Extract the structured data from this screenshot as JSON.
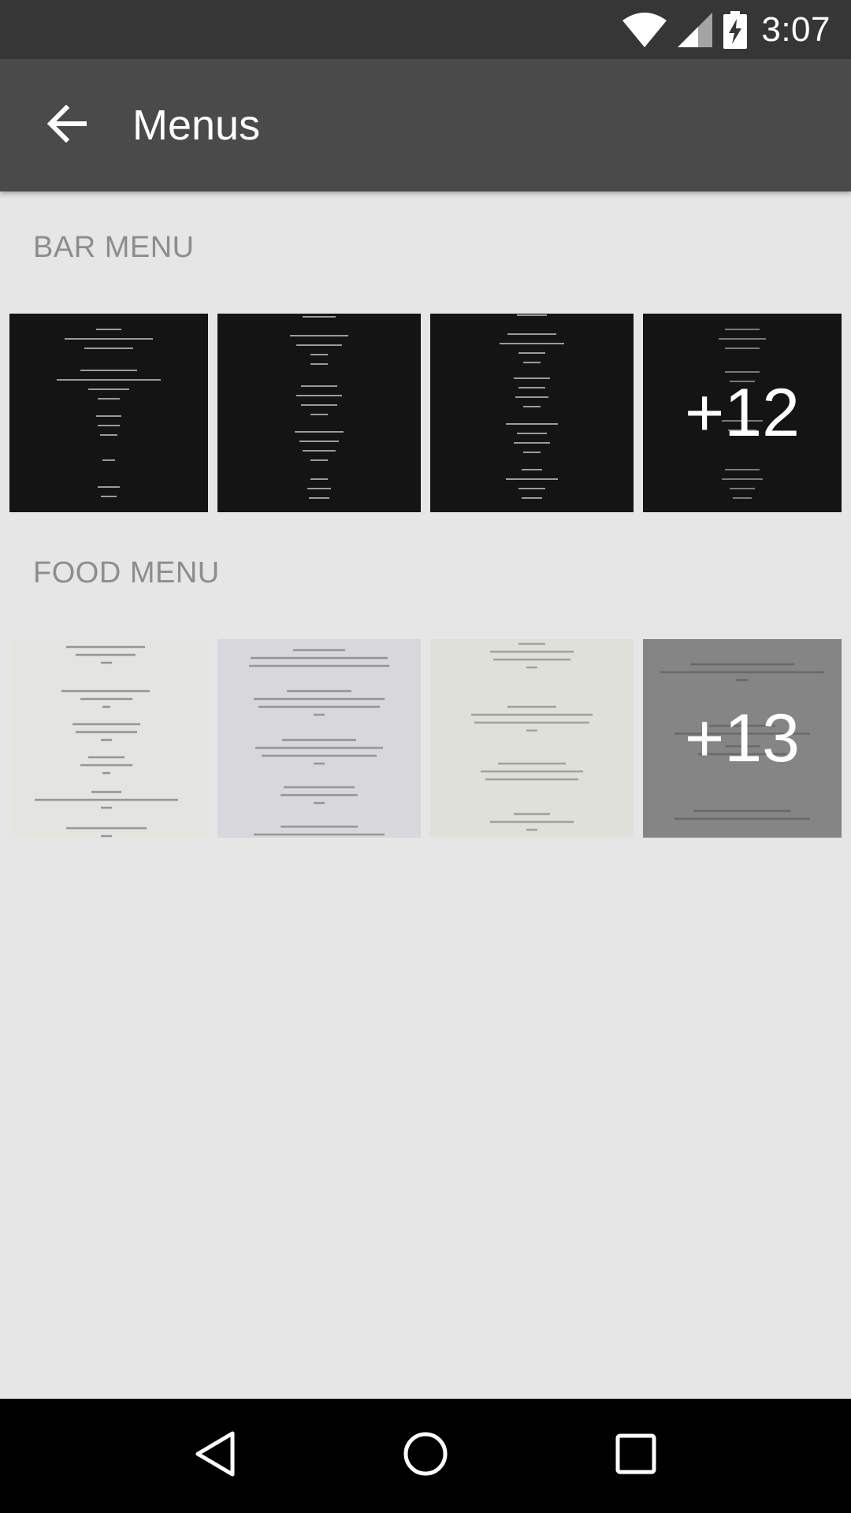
{
  "status_bar": {
    "time": "3:07",
    "icons": [
      "wifi-icon",
      "cell-signal-icon",
      "battery-charging-icon"
    ]
  },
  "app_bar": {
    "title": "Menus",
    "back_icon": "arrow-back-icon"
  },
  "sections": [
    {
      "title": "BAR MENU",
      "thumbnail_style": "dark",
      "thumbnails": 4,
      "more_count": "+12"
    },
    {
      "title": "FOOD MENU",
      "thumbnail_style": "light",
      "thumbnails": 4,
      "more_count": "+13"
    }
  ],
  "nav_bar": {
    "icons": [
      "nav-back-icon",
      "nav-home-icon",
      "nav-recents-icon"
    ]
  },
  "colors": {
    "status_bar": "#363636",
    "app_bar": "#4a4a4a",
    "background": "#e6e6e6",
    "section_title": "#8d8d8d"
  }
}
